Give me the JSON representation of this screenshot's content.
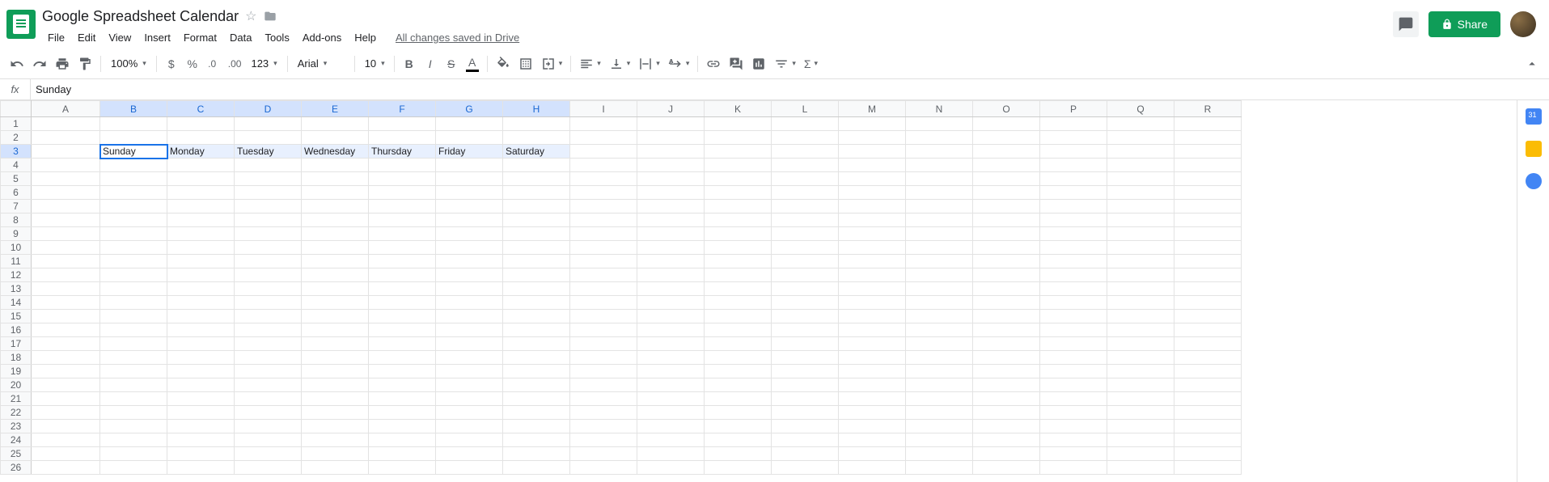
{
  "doc": {
    "title": "Google Spreadsheet Calendar",
    "saved_status": "All changes saved in Drive"
  },
  "menus": [
    "File",
    "Edit",
    "View",
    "Insert",
    "Format",
    "Data",
    "Tools",
    "Add-ons",
    "Help"
  ],
  "share_label": "Share",
  "toolbar": {
    "zoom": "100%",
    "num_format": "123",
    "font": "Arial",
    "font_size": "10"
  },
  "formula_bar": {
    "fx": "fx",
    "value": "Sunday"
  },
  "columns": [
    "A",
    "B",
    "C",
    "D",
    "E",
    "F",
    "G",
    "H",
    "I",
    "J",
    "K",
    "L",
    "M",
    "N",
    "O",
    "P",
    "Q",
    "R"
  ],
  "row_count": 26,
  "selected_cols": [
    "B",
    "C",
    "D",
    "E",
    "F",
    "G",
    "H"
  ],
  "selected_row": 3,
  "active_cell": {
    "col": "B",
    "row": 3
  },
  "cells": {
    "B3": "Sunday",
    "C3": "Monday",
    "D3": "Tuesday",
    "E3": "Wednesday",
    "F3": "Thursday",
    "G3": "Friday",
    "H3": "Saturday"
  },
  "col_widths": {
    "A": 85,
    "default": 83
  }
}
